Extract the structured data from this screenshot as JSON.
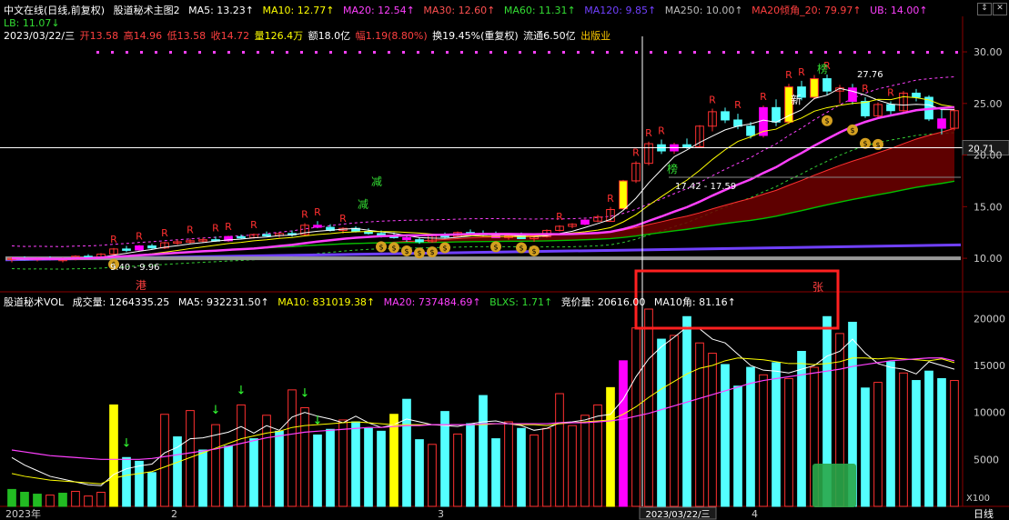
{
  "header": {
    "stock": "中文在线(日线,前复权)",
    "indicator": "股道秘术主图2",
    "ma5": "MA5: 13.23↑",
    "ma10": "MA10: 12.77↑",
    "ma20": "MA20: 12.54↑",
    "ma30": "MA30: 12.60↑",
    "ma60": "MA60: 11.31↑",
    "ma120": "MA120: 9.85↑",
    "ma250": "MA250: 10.00↑",
    "ma20a": "MA20倾角_20: 79.97↑",
    "ub": "UB: 14.00↑",
    "lb": "LB: 11.07↓"
  },
  "quote": {
    "date": "2023/03/22/三",
    "open": "开13.58",
    "high": "高14.96",
    "low": "低13.58",
    "close": "收14.72",
    "vol": "量126.4万",
    "amount": "额18.0亿",
    "change": "幅1.19(8.80%)",
    "turnover": "换19.45%(重复权)",
    "float": "流通6.50亿",
    "sector": "出版业"
  },
  "vol_header": {
    "name": "股道秘术VOL",
    "vol": "成交量: 1264335.25",
    "ma5": "MA5: 932231.50↑",
    "ma10": "MA10: 831019.38↑",
    "ma20": "MA20: 737484.69↑",
    "blxs": "BLXS: 1.71↑",
    "jjl": "竞价量: 20616.00",
    "ma10j": "MA10角: 81.16↑"
  },
  "colors": {
    "up": "#ff3030",
    "down": "#54ffff",
    "ma5": "#ffffff",
    "ma10": "#ffff00",
    "ma20": "#ff40ff",
    "ma60": "#00c000",
    "ma120": "#7040ff",
    "ma250": "#999999"
  },
  "chart_data": {
    "type": "candlestick",
    "price_axis": [
      30,
      25,
      20,
      15,
      10
    ],
    "ylim": [
      8.6,
      31.5
    ],
    "vol_axis": [
      20000,
      15000,
      10000,
      5000
    ],
    "vol_unit": "X100",
    "vol_ylim": [
      0,
      21000
    ],
    "x_labels": [
      "2023年",
      "2",
      "3",
      "2023/03/22/三",
      "4",
      "日线"
    ],
    "crosshair_price": "20.71",
    "range_label": "17.42 - 17.59",
    "high_label": "27.76",
    "low_label": "9.40 - 9.96",
    "bars": [
      [
        9.9,
        10.1,
        9.6,
        10.0
      ],
      [
        10.0,
        10.2,
        9.8,
        9.9
      ],
      [
        9.9,
        10.1,
        9.7,
        10.0
      ],
      [
        10.0,
        10.2,
        9.8,
        9.9
      ],
      [
        9.9,
        10.1,
        9.6,
        9.9
      ],
      [
        9.9,
        10.3,
        9.8,
        10.2
      ],
      [
        10.2,
        10.4,
        10.0,
        10.1
      ],
      [
        10.1,
        10.5,
        10.0,
        10.4
      ],
      [
        10.4,
        11.0,
        10.3,
        10.9
      ],
      [
        10.9,
        11.2,
        10.6,
        10.8
      ],
      [
        10.8,
        11.3,
        10.7,
        11.2
      ],
      [
        11.2,
        11.4,
        10.9,
        11.0
      ],
      [
        11.0,
        11.6,
        10.9,
        11.5
      ],
      [
        11.5,
        11.8,
        11.3,
        11.6
      ],
      [
        11.6,
        11.9,
        11.4,
        11.7
      ],
      [
        11.7,
        12.0,
        11.5,
        11.8
      ],
      [
        11.8,
        12.1,
        11.6,
        11.7
      ],
      [
        11.7,
        12.2,
        11.6,
        12.1
      ],
      [
        12.1,
        12.3,
        11.9,
        12.0
      ],
      [
        12.0,
        12.4,
        11.9,
        12.3
      ],
      [
        12.3,
        12.6,
        12.1,
        12.2
      ],
      [
        12.2,
        12.5,
        12.0,
        12.4
      ],
      [
        12.4,
        12.7,
        12.1,
        12.3
      ],
      [
        12.3,
        13.4,
        12.2,
        13.2
      ],
      [
        13.2,
        13.6,
        12.9,
        13.0
      ],
      [
        13.0,
        13.3,
        12.6,
        12.7
      ],
      [
        12.7,
        13.0,
        12.4,
        12.9
      ],
      [
        12.9,
        13.1,
        12.5,
        12.6
      ],
      [
        12.6,
        12.9,
        12.3,
        12.4
      ],
      [
        12.4,
        12.7,
        12.0,
        12.2
      ],
      [
        12.2,
        12.5,
        11.9,
        12.0
      ],
      [
        12.0,
        12.2,
        11.6,
        11.8
      ],
      [
        11.8,
        12.0,
        11.4,
        11.6
      ],
      [
        11.6,
        12.3,
        11.5,
        12.2
      ],
      [
        12.2,
        12.5,
        11.9,
        12.1
      ],
      [
        12.1,
        12.6,
        12.0,
        12.5
      ],
      [
        12.5,
        12.8,
        12.2,
        12.4
      ],
      [
        12.4,
        12.7,
        12.1,
        12.3
      ],
      [
        12.3,
        12.6,
        12.0,
        12.0
      ],
      [
        12.0,
        12.4,
        11.8,
        12.2
      ],
      [
        12.2,
        12.5,
        11.9,
        11.9
      ],
      [
        11.9,
        12.2,
        11.6,
        12.1
      ],
      [
        12.1,
        12.8,
        12.0,
        12.7
      ],
      [
        12.7,
        13.2,
        12.6,
        13.1
      ],
      [
        13.1,
        13.4,
        12.9,
        13.3
      ],
      [
        13.3,
        13.8,
        13.2,
        13.7
      ],
      [
        13.6,
        14.2,
        13.5,
        14.0
      ],
      [
        13.58,
        14.96,
        13.58,
        14.72
      ],
      [
        14.8,
        17.6,
        14.7,
        17.5
      ],
      [
        17.5,
        19.4,
        17.3,
        19.2
      ],
      [
        19.2,
        21.3,
        19.0,
        21.1
      ],
      [
        21.0,
        21.5,
        20.1,
        20.4
      ],
      [
        20.4,
        21.2,
        20.1,
        21.0
      ],
      [
        21.0,
        21.6,
        20.6,
        20.8
      ],
      [
        20.8,
        22.9,
        20.7,
        22.8
      ],
      [
        22.8,
        24.5,
        22.3,
        24.2
      ],
      [
        24.2,
        24.6,
        23.1,
        23.4
      ],
      [
        23.4,
        24.0,
        22.5,
        22.8
      ],
      [
        22.8,
        23.2,
        21.6,
        21.9
      ],
      [
        21.9,
        24.8,
        21.7,
        24.6
      ],
      [
        24.6,
        25.4,
        22.8,
        23.2
      ],
      [
        23.2,
        26.9,
        23.0,
        26.6
      ],
      [
        26.6,
        27.2,
        25.3,
        25.6
      ],
      [
        25.6,
        27.76,
        25.4,
        27.4
      ],
      [
        27.4,
        27.8,
        25.8,
        26.2
      ],
      [
        26.2,
        26.8,
        25.0,
        26.5
      ],
      [
        26.5,
        26.9,
        24.9,
        25.2
      ],
      [
        25.2,
        25.6,
        23.6,
        23.8
      ],
      [
        23.8,
        25.1,
        23.5,
        24.9
      ],
      [
        24.9,
        25.2,
        23.9,
        24.3
      ],
      [
        24.3,
        26.2,
        24.0,
        26.0
      ],
      [
        26.0,
        26.4,
        25.2,
        25.6
      ],
      [
        25.6,
        25.8,
        23.3,
        23.5
      ],
      [
        23.5,
        24.6,
        22.0,
        22.6
      ],
      [
        22.6,
        24.5,
        22.4,
        24.3
      ]
    ],
    "volume": [
      1800,
      1500,
      1300,
      1200,
      1400,
      1600,
      1100,
      1500,
      10800,
      5200,
      4800,
      3600,
      9800,
      7400,
      10200,
      6000,
      8700,
      6400,
      10800,
      7200,
      9700,
      8000,
      12400,
      10500,
      7600,
      8200,
      9200,
      9000,
      8300,
      8000,
      9800,
      11400,
      7100,
      6600,
      10100,
      7700,
      8800,
      11800,
      7200,
      9000,
      8300,
      7600,
      8300,
      12000,
      8600,
      9700,
      10800,
      12643,
      15500,
      19000,
      21000,
      17800,
      18200,
      20200,
      17400,
      16300,
      15100,
      12800,
      14800,
      14000,
      15300,
      13600,
      16500,
      14800,
      20200,
      18400,
      19600,
      12600,
      13200,
      15400,
      14200,
      13400,
      14400,
      13600,
      13400
    ],
    "volume_down_color": [
      false,
      false,
      false,
      false,
      false,
      false,
      false,
      false,
      false,
      true,
      true,
      true,
      false,
      true,
      false,
      true,
      false,
      true,
      false,
      true,
      false,
      true,
      false,
      false,
      true,
      true,
      false,
      true,
      true,
      true,
      true,
      true,
      true,
      false,
      true,
      false,
      true,
      true,
      true,
      false,
      true,
      false,
      false,
      false,
      false,
      false,
      false,
      false,
      false,
      false,
      false,
      true,
      false,
      true,
      false,
      false,
      true,
      true,
      true,
      false,
      true,
      false,
      true,
      false,
      true,
      false,
      true,
      true,
      false,
      true,
      false,
      true,
      true,
      true,
      false
    ],
    "volume_ma5": [
      5200,
      4400,
      3800,
      3200,
      2900,
      2600,
      2300,
      2200,
      3400,
      4000,
      4300,
      4500,
      5700,
      6300,
      7200,
      7300,
      7600,
      7900,
      8500,
      7800,
      8600,
      8100,
      9500,
      10000,
      9600,
      9300,
      8900,
      9600,
      8900,
      8400,
      8700,
      9300,
      9000,
      8700,
      8600,
      8500,
      8800,
      9000,
      9100,
      8800,
      8600,
      8100,
      8300,
      8900,
      9000,
      9200,
      9600,
      9800,
      11400,
      13800,
      15700,
      17000,
      18000,
      19100,
      18900,
      17800,
      17400,
      16200,
      15000,
      14500,
      14400,
      14200,
      14600,
      15000,
      16000,
      16500,
      17800,
      16300,
      15200,
      14800,
      14600,
      14100,
      15400,
      15000,
      14600
    ],
    "volume_ma10": [
      3500,
      3200,
      3000,
      2800,
      2700,
      2600,
      2500,
      2400,
      3000,
      3300,
      3500,
      3700,
      4200,
      4700,
      5200,
      5700,
      6200,
      6700,
      7200,
      7500,
      7800,
      8000,
      8400,
      8600,
      8700,
      8800,
      8900,
      9000,
      8900,
      8800,
      8700,
      8700,
      8700,
      8700,
      8700,
      8700,
      8700,
      8700,
      8800,
      8800,
      8700,
      8700,
      8600,
      8800,
      8900,
      9000,
      9100,
      9200,
      9800,
      10600,
      11600,
      12500,
      13300,
      14100,
      14700,
      15000,
      15500,
      15800,
      15700,
      15600,
      15400,
      15200,
      15200,
      15100,
      15200,
      15400,
      15800,
      15800,
      15700,
      15800,
      15700,
      15600,
      15500,
      15700,
      15300
    ],
    "volume_ma20": [
      6000,
      5800,
      5600,
      5400,
      5300,
      5200,
      5100,
      5000,
      5000,
      5000,
      5000,
      5100,
      5300,
      5500,
      5700,
      5900,
      6100,
      6400,
      6700,
      7000,
      7300,
      7500,
      7700,
      7900,
      8000,
      8100,
      8200,
      8300,
      8400,
      8400,
      8500,
      8600,
      8600,
      8700,
      8700,
      8700,
      8700,
      8800,
      8800,
      8800,
      8800,
      8800,
      8800,
      8900,
      8900,
      8900,
      9000,
      9100,
      9300,
      9600,
      9900,
      10300,
      10700,
      11100,
      11500,
      11900,
      12300,
      12700,
      13100,
      13400,
      13600,
      13800,
      14000,
      14200,
      14400,
      14600,
      14900,
      15100,
      15300,
      15500,
      15600,
      15700,
      15800,
      15800,
      15500
    ],
    "annotations": {
      "R": [
        8,
        10,
        12,
        14,
        16,
        17,
        19,
        23,
        24,
        26,
        43,
        47,
        49,
        50,
        51,
        55,
        57,
        59,
        61,
        62,
        64,
        67,
        69
      ],
      "money_bag": [
        8,
        29,
        30,
        31,
        32,
        33,
        34,
        38,
        40,
        41,
        64,
        66,
        67,
        68
      ],
      "green_arrows": [
        9,
        16,
        18,
        23,
        24
      ]
    },
    "legend": [
      "港",
      "减",
      "减",
      "榜",
      "新",
      "榜",
      "张"
    ]
  }
}
